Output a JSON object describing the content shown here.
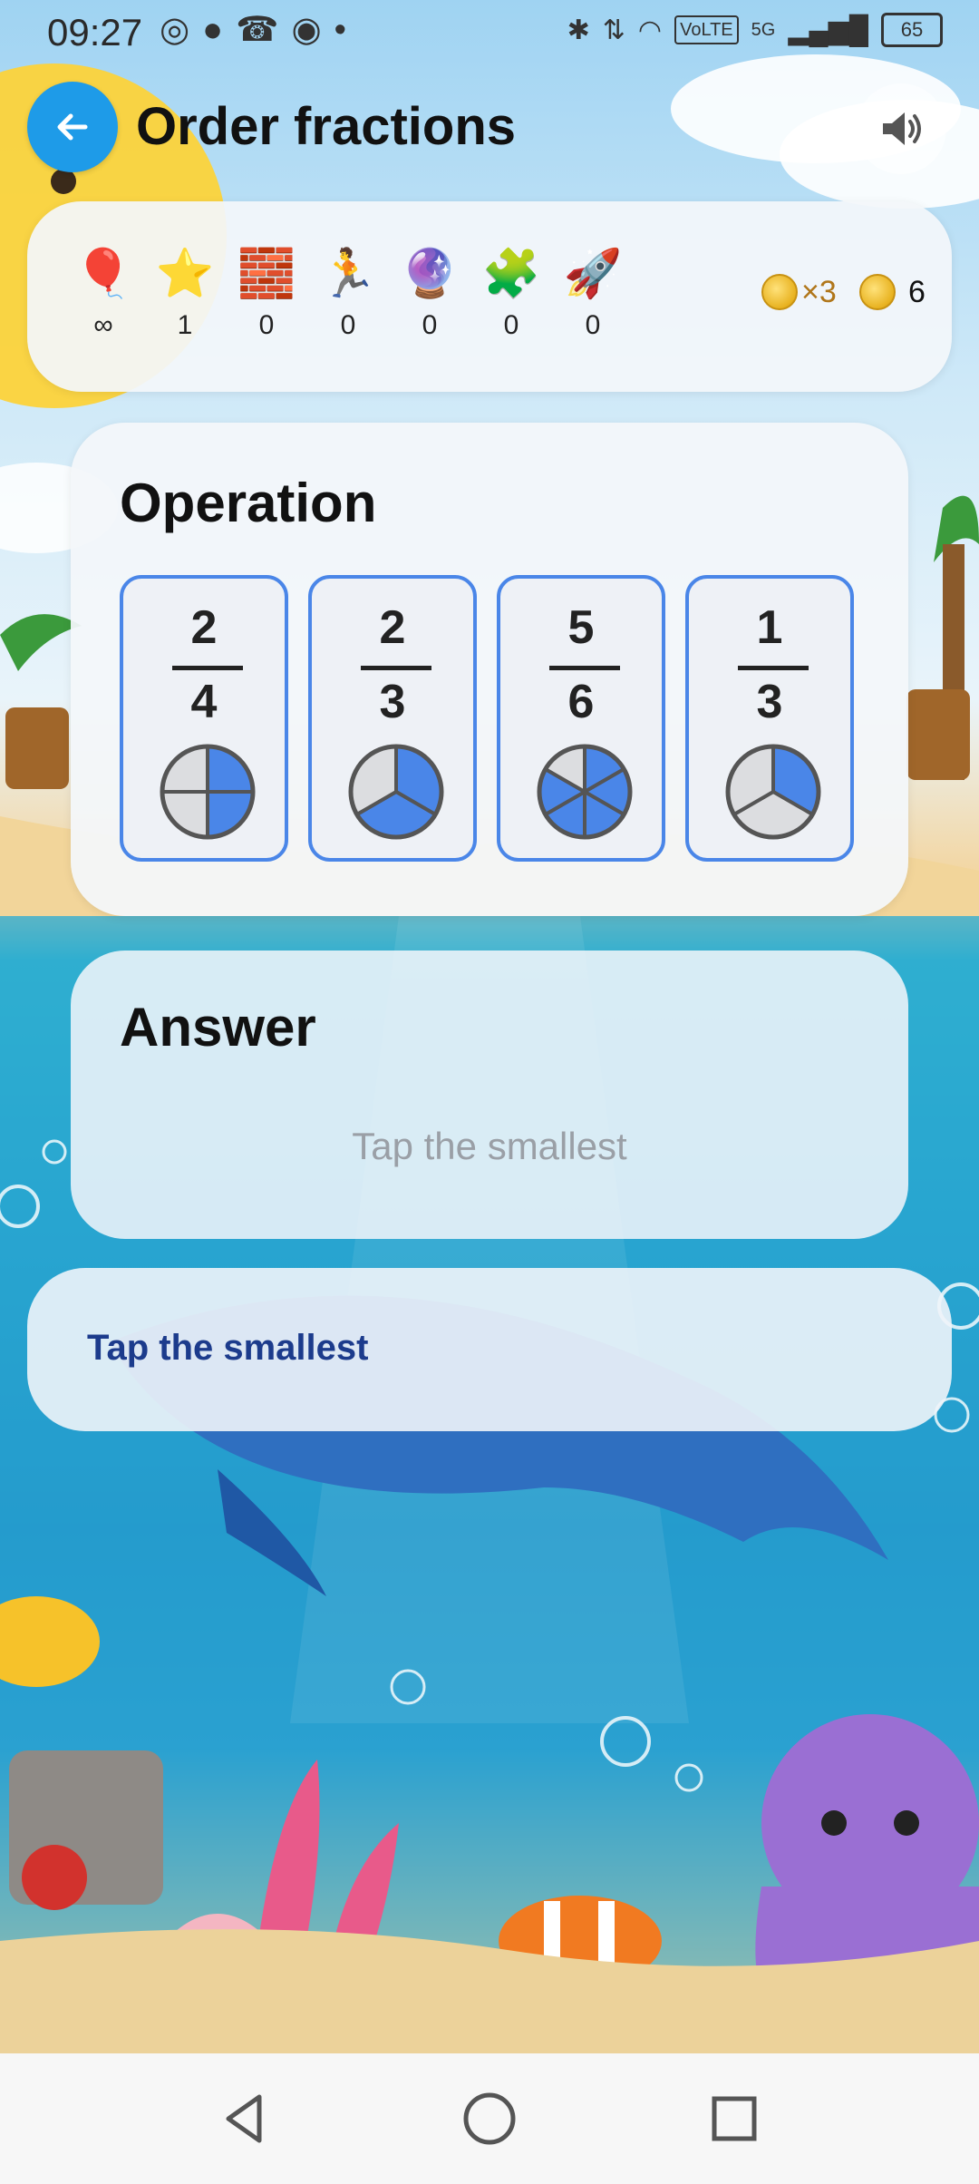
{
  "status_bar": {
    "time": "09:27",
    "left_icons": [
      "whatsapp-icon",
      "chat-icon",
      "missed-call-icon",
      "messenger-icon",
      "dot-icon"
    ],
    "volte_label": "VoLTE",
    "network_label": "5G",
    "battery_level": "65"
  },
  "header": {
    "title": "Order fractions",
    "back_icon": "arrow-left-icon",
    "sound_icon": "speaker-icon"
  },
  "stats": {
    "items": [
      {
        "icon": "🎈",
        "name": "balloon",
        "value": "∞"
      },
      {
        "icon": "⭐",
        "name": "star",
        "value": "1"
      },
      {
        "icon": "🧱",
        "name": "brick",
        "value": "0"
      },
      {
        "icon": "🏃",
        "name": "runner",
        "value": "0"
      },
      {
        "icon": "🔮",
        "name": "crystal-ball",
        "value": "0"
      },
      {
        "icon": "🧩",
        "name": "puzzle",
        "value": "0"
      },
      {
        "icon": "🚀",
        "name": "rocket",
        "value": "0"
      }
    ],
    "multiplier": "×3",
    "coins": "6"
  },
  "operation": {
    "title": "Operation",
    "fractions": [
      {
        "numerator": "2",
        "denominator": "4",
        "filled": 2,
        "slices": 4
      },
      {
        "numerator": "2",
        "denominator": "3",
        "filled": 2,
        "slices": 3
      },
      {
        "numerator": "5",
        "denominator": "6",
        "filled": 5,
        "slices": 6
      },
      {
        "numerator": "1",
        "denominator": "3",
        "filled": 1,
        "slices": 3
      }
    ]
  },
  "answer": {
    "title": "Answer",
    "placeholder": "Tap the smallest"
  },
  "hint": {
    "text": "Tap the smallest"
  },
  "colors": {
    "accent": "#1e9be8",
    "card_border": "#4a86e8",
    "pie_fill": "#4a86e8",
    "pie_empty": "#dcdde0",
    "hint_text": "#1c3b8c"
  }
}
